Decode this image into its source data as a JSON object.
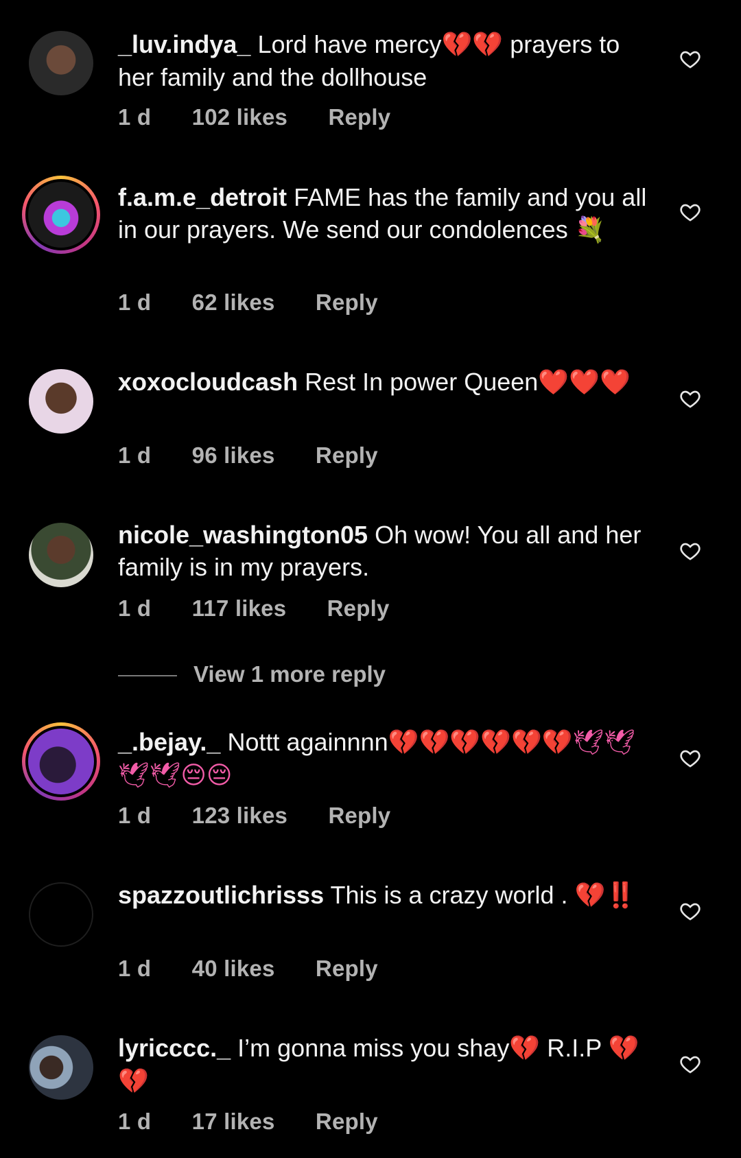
{
  "comments": [
    {
      "username": "_luv.indya_",
      "text": "Lord have mercy",
      "emoji": "💔💔",
      "text2": " prayers to her family and the dollhouse",
      "time": "1 d",
      "likes": "102 likes",
      "reply": "Reply"
    },
    {
      "username": "f.a.m.e_detroit",
      "text": "FAME has the family and you all in our prayers. We send our condolences ",
      "emoji": "💐",
      "text2": "",
      "time": "1 d",
      "likes": "62 likes",
      "reply": "Reply"
    },
    {
      "username": "xoxocloudcash",
      "text": "Rest In power Queen",
      "emoji": "❤️❤️❤️",
      "text2": "",
      "time": "1 d",
      "likes": "96 likes",
      "reply": "Reply"
    },
    {
      "username": "nicole_washington05",
      "text": "Oh wow! You all and her family is in my prayers.",
      "emoji": "",
      "text2": "",
      "time": "1 d",
      "likes": "117 likes",
      "reply": "Reply"
    },
    {
      "username": "_.bejay._",
      "text": "Nottt againnnn",
      "emoji": "💔💔💔💔💔💔🕊🕊🕊🕊😔😔",
      "text2": "",
      "time": "1 d",
      "likes": "123 likes",
      "reply": "Reply"
    },
    {
      "username": "spazzoutlichrisss",
      "text": "This is a crazy world . ",
      "emoji": "💔‼️",
      "text2": "",
      "time": "1 d",
      "likes": "40 likes",
      "reply": "Reply"
    },
    {
      "username": "lyricccc._",
      "text": "I’m gonna miss you shay",
      "emoji": "💔",
      "text2": " R.I.P ",
      "emoji2": "💔💔",
      "time": "1 d",
      "likes": "17 likes",
      "reply": "Reply"
    }
  ],
  "view_more": "View 1 more reply",
  "colors": {
    "background": "#000000",
    "meta": "#b3b3b3",
    "heart_red": "#f0263c",
    "broken_heart": "#f25ca8"
  },
  "icons": [
    "like-heart-icon"
  ]
}
